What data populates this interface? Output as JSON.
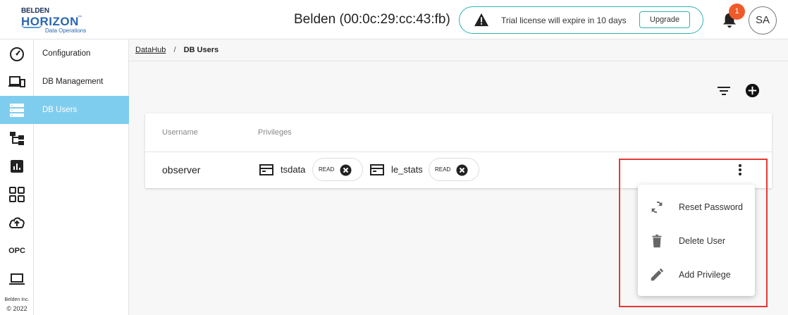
{
  "header": {
    "logo": {
      "brand": "BELDEN",
      "product": "HORIZON",
      "trademark": "™",
      "tagline": "Data Operations"
    },
    "device_title": "Belden (00:0c:29:cc:43:fb)",
    "license_message": "Trial license will expire in 10 days",
    "upgrade_label": "Upgrade",
    "notification_count": "1",
    "avatar_initials": "SA"
  },
  "rail": {
    "icons": [
      "dashboard-icon",
      "devices-icon",
      "db-users-icon",
      "hierarchy-icon",
      "analytics-icon",
      "apps-grid-icon",
      "cloud-upload-icon",
      "opc-icon",
      "laptop-icon"
    ],
    "opc_label": "OPC",
    "copyright_line1": "Belden Inc.",
    "copyright_line2": "© 2022"
  },
  "submenu": {
    "items": [
      {
        "label": "Configuration",
        "active": false
      },
      {
        "label": "DB Management",
        "active": false
      },
      {
        "label": "DB Users",
        "active": true
      }
    ]
  },
  "breadcrumb": {
    "parent": "DataHub",
    "separator": "/",
    "current": "DB Users"
  },
  "table": {
    "headers": [
      "Username",
      "Privileges"
    ],
    "rows": [
      {
        "username": "observer",
        "privileges": [
          {
            "database": "tsdata",
            "access": "READ"
          },
          {
            "database": "le_stats",
            "access": "READ"
          }
        ]
      }
    ]
  },
  "context_menu": {
    "items": [
      {
        "label": "Reset Password",
        "icon": "refresh-icon"
      },
      {
        "label": "Delete User",
        "icon": "trash-icon"
      },
      {
        "label": "Add Privilege",
        "icon": "pencil-icon"
      }
    ]
  },
  "colors": {
    "accent": "#7fcdee",
    "pill_border": "#2bb3b3",
    "badge": "#ef5a29",
    "highlight": "#e53935"
  }
}
